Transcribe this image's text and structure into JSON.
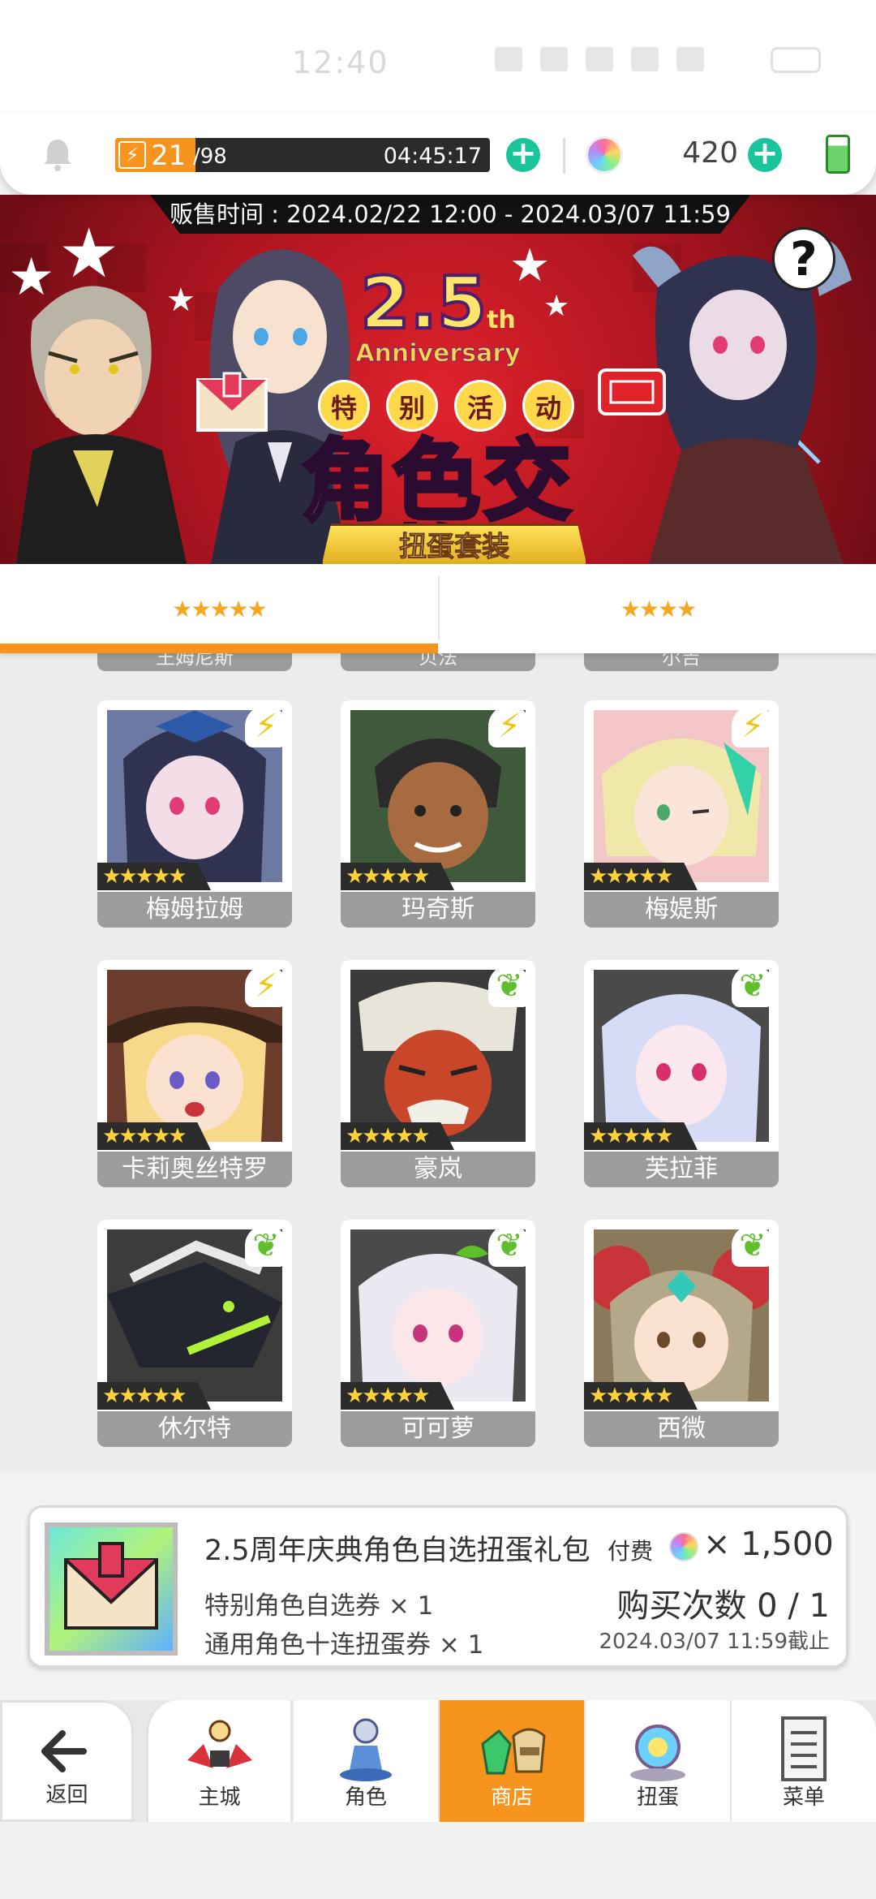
{
  "resources": {
    "stamina_current": "21",
    "stamina_max": "/98",
    "stamina_fraction": 0.214,
    "stamina_timer": "04:45:17",
    "gem_count": "420"
  },
  "banner": {
    "sale_time": "贩售时间 : 2024.02/22 12:00 - 2024.03/07 11:59",
    "anniversary_number": "2.5",
    "anniversary_suffix": "th",
    "anniversary_word": "Anniversary",
    "event_tags": [
      "特",
      "别",
      "活",
      "动"
    ],
    "title": "角色交换",
    "subtitle": "扭蛋套装",
    "help_symbol": "?"
  },
  "tabs": [
    {
      "label": "★★★★★",
      "active": true
    },
    {
      "label": "★★★★",
      "active": false
    }
  ],
  "partial_row": [
    "王姆尼斯",
    "贝法",
    "尔吉"
  ],
  "characters": [
    {
      "name": "梅姆拉姆",
      "rarity": "★★★★★",
      "element": "thunder"
    },
    {
      "name": "玛奇斯",
      "rarity": "★★★★★",
      "element": "thunder"
    },
    {
      "name": "梅媞斯",
      "rarity": "★★★★★",
      "element": "thunder"
    },
    {
      "name": "卡莉奥丝特罗",
      "rarity": "★★★★★",
      "element": "thunder"
    },
    {
      "name": "豪岚",
      "rarity": "★★★★★",
      "element": "wind"
    },
    {
      "name": "芙拉菲",
      "rarity": "★★★★★",
      "element": "wind"
    },
    {
      "name": "休尔特",
      "rarity": "★★★★★",
      "element": "wind"
    },
    {
      "name": "可可萝",
      "rarity": "★★★★★",
      "element": "wind"
    },
    {
      "name": "西微",
      "rarity": "★★★★★",
      "element": "wind"
    }
  ],
  "product": {
    "title": "2.5周年庆典角色自选扭蛋礼包",
    "paid_label": "付费",
    "price": "× 1,500",
    "item1": "特别角色自选券 × 1",
    "item2": "通用角色十连扭蛋券 × 1",
    "purchase_limit": "购买次数 0 / 1",
    "deadline": "2024.03/07 11:59截止"
  },
  "nav": {
    "back": "返回",
    "items": [
      "主城",
      "角色",
      "商店",
      "扭蛋",
      "菜单"
    ],
    "active_index": 2
  },
  "colors": {
    "accent": "#f7941d",
    "plus_button": "#19c49a",
    "card_gray": "#9c9c9c",
    "banner_red": "#c81a24"
  }
}
